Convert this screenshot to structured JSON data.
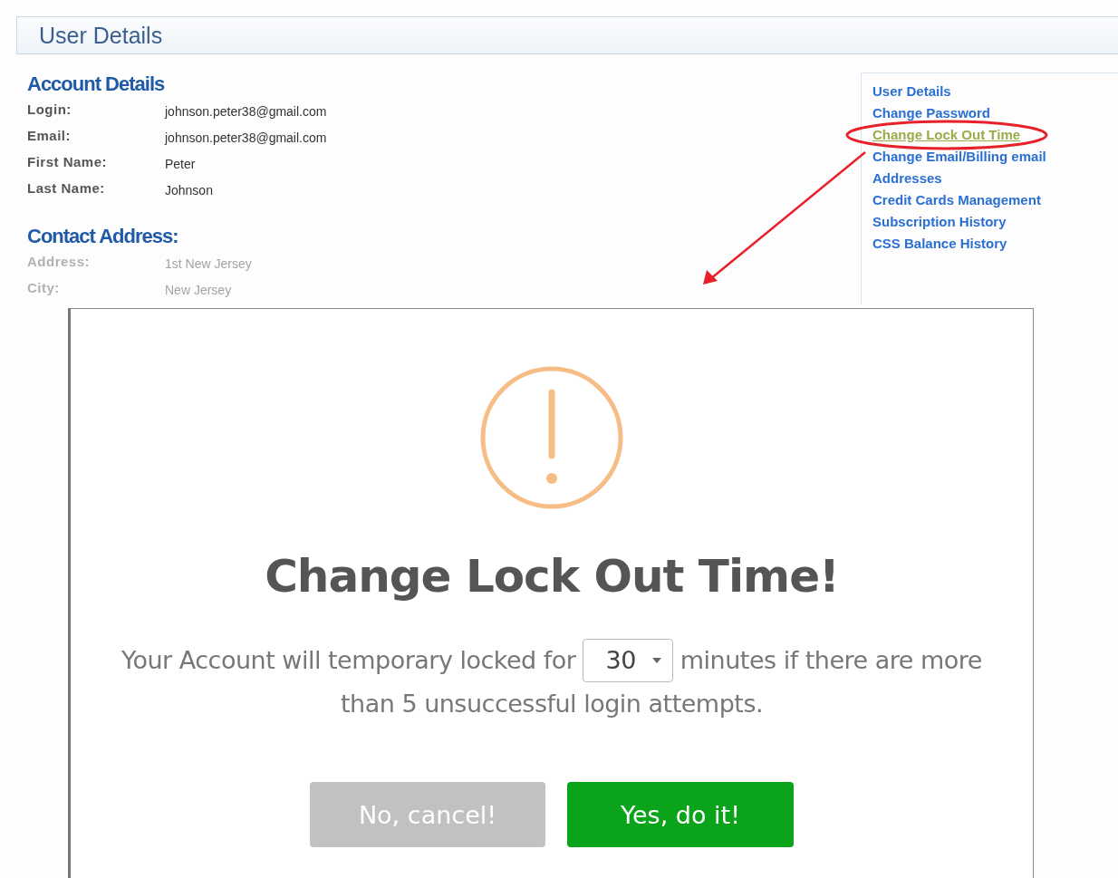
{
  "header": {
    "title": "User Details"
  },
  "account_details": {
    "title": "Account Details",
    "fields": [
      {
        "label": "Login:",
        "value": "johnson.peter38@gmail.com"
      },
      {
        "label": "Email:",
        "value": "johnson.peter38@gmail.com"
      },
      {
        "label": "First Name:",
        "value": "Peter"
      },
      {
        "label": "Last Name:",
        "value": "Johnson"
      }
    ]
  },
  "contact_address": {
    "title": "Contact Address:",
    "fields": [
      {
        "label": "Address:",
        "value": "1st New Jersey"
      },
      {
        "label": "City:",
        "value": "New Jersey"
      }
    ]
  },
  "sidebar": {
    "items": [
      {
        "label": "User Details",
        "selected": false
      },
      {
        "label": "Change Password",
        "selected": false
      },
      {
        "label": "Change Lock Out Time",
        "selected": true
      },
      {
        "label": "Change Email/Billing email",
        "selected": false
      },
      {
        "label": "Addresses",
        "selected": false
      },
      {
        "label": "Credit Cards Management",
        "selected": false
      },
      {
        "label": "Subscription History",
        "selected": false
      },
      {
        "label": "CSS Balance History",
        "selected": false
      }
    ]
  },
  "dialog": {
    "title": "Change Lock Out Time!",
    "text_before": "Your Account will temporary locked for",
    "select_value": "30",
    "text_after": "minutes if there are more",
    "text_line2": "than 5 unsuccessful login attempts.",
    "buttons": [
      {
        "label": "No, cancel!",
        "kind": "cancel"
      },
      {
        "label": "Yes, do it!",
        "kind": "confirm"
      }
    ]
  }
}
